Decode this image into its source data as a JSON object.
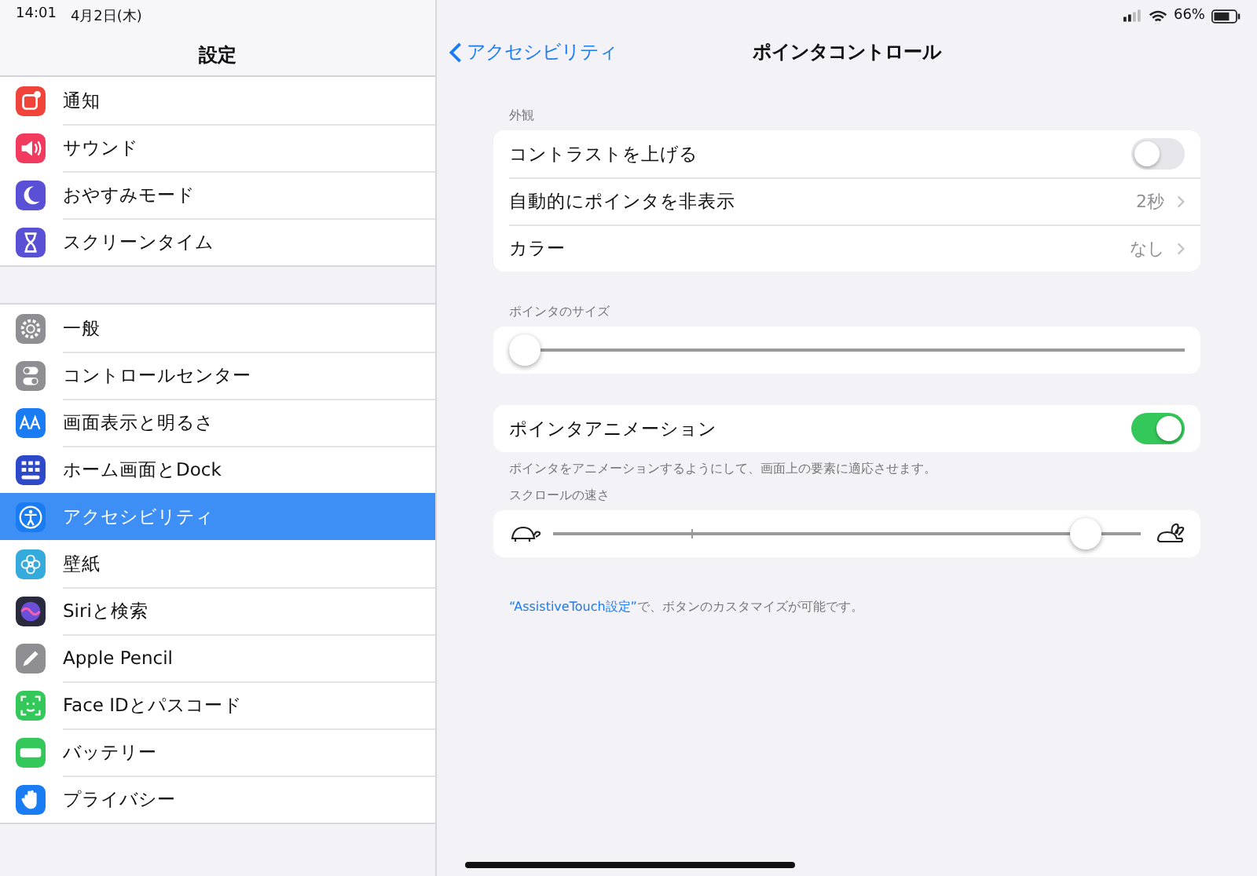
{
  "status_bar": {
    "time": "14:01",
    "date": "4月2日(木)",
    "battery": "66%"
  },
  "sidebar": {
    "title": "設定",
    "groups": [
      {
        "items": [
          {
            "label": "通知",
            "kind": "notification",
            "color": "#f0443a",
            "selected": false
          },
          {
            "label": "サウンド",
            "kind": "sound",
            "color": "#f23a5e",
            "selected": false
          },
          {
            "label": "おやすみモード",
            "kind": "moon",
            "color": "#5a50d6",
            "selected": false
          },
          {
            "label": "スクリーンタイム",
            "kind": "hourglass",
            "color": "#5a50d6",
            "selected": false
          }
        ]
      },
      {
        "items": [
          {
            "label": "一般",
            "kind": "gear",
            "color": "#8e8e93",
            "selected": false
          },
          {
            "label": "コントロールセンター",
            "kind": "toggles",
            "color": "#8e8e93",
            "selected": false
          },
          {
            "label": "画面表示と明るさ",
            "kind": "text",
            "color": "#1a7cf2",
            "selected": false
          },
          {
            "label": "ホーム画面とDock",
            "kind": "grid",
            "color": "#2d48c8",
            "selected": false
          },
          {
            "label": "アクセシビリティ",
            "kind": "accessibility",
            "color": "#1a7cf2",
            "selected": true
          },
          {
            "label": "壁紙",
            "kind": "flower",
            "color": "#35aadc",
            "selected": false
          },
          {
            "label": "Siriと検索",
            "kind": "siri",
            "color": "#2a2a3e",
            "selected": false
          },
          {
            "label": "Apple Pencil",
            "kind": "pencil",
            "color": "#8e8e93",
            "selected": false
          },
          {
            "label": "Face IDとパスコード",
            "kind": "face",
            "color": "#34c759",
            "selected": false
          },
          {
            "label": "バッテリー",
            "kind": "battery",
            "color": "#34c759",
            "selected": false
          },
          {
            "label": "プライバシー",
            "kind": "hand",
            "color": "#1a7cf2",
            "selected": false
          }
        ]
      }
    ]
  },
  "detail": {
    "back": "アクセシビリティ",
    "title": "ポインタコントロール",
    "sections": [
      {
        "header": "外観",
        "rows": [
          {
            "kind": "toggle",
            "label": "コントラストを上げる",
            "on": false
          },
          {
            "kind": "link",
            "label": "自動的にポインタを非表示",
            "value": "2秒"
          },
          {
            "kind": "link",
            "label": "カラー",
            "value": "なし"
          }
        ]
      },
      {
        "header": "ポインタのサイズ",
        "rows": [
          {
            "kind": "slider",
            "level": 0
          }
        ]
      },
      {
        "rows": [
          {
            "kind": "toggle",
            "label": "ポインタアニメーション",
            "on": true
          }
        ],
        "footer": "ポインタをアニメーションするようにして、画面上の要素に適応させます。"
      },
      {
        "header": "スクロールの速さ",
        "rows": [
          {
            "kind": "speed",
            "level": 0.93
          }
        ]
      }
    ],
    "note": {
      "link": "“AssistiveTouch設定”",
      "text": "で、ボタンのカスタマイズが可能です。"
    }
  }
}
